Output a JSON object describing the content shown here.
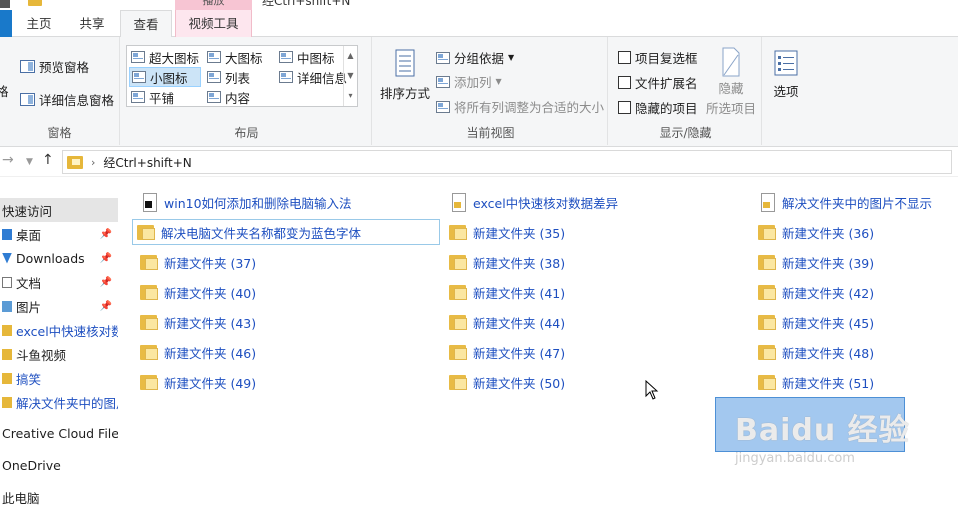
{
  "window": {
    "title": "经Ctrl+shift+N"
  },
  "ribbon_tabs": {
    "context_header": "播放",
    "tabs": [
      "主页",
      "共享",
      "查看",
      "视频工具"
    ],
    "active": "查看"
  },
  "ribbon": {
    "panes_group": {
      "label": "窗格",
      "preview_pane": "预览窗格",
      "details_pane": "详细信息窗格",
      "nav_pane_partial": "格"
    },
    "layout_group": {
      "label": "布局",
      "items": [
        "超大图标",
        "大图标",
        "中图标",
        "小图标",
        "列表",
        "详细信息",
        "平铺",
        "内容"
      ],
      "selected": "小图标"
    },
    "current_view_group": {
      "label": "当前视图",
      "sort_by": "排序方式",
      "group_by": "分组依据",
      "add_columns": "添加列",
      "fit_columns": "将所有列调整为合适的大小"
    },
    "show_hide_group": {
      "label": "显示/隐藏",
      "item_checkboxes": "项目复选框",
      "file_extensions": "文件扩展名",
      "hidden_items": "隐藏的项目",
      "hide_selected": "隐藏",
      "hide_selected_sub": "所选项目"
    },
    "options": "选项"
  },
  "address": {
    "path": "经Ctrl+shift+N"
  },
  "nav_pane": {
    "quick_access": "快速访问",
    "items": [
      {
        "label": "桌面",
        "pinned": true
      },
      {
        "label": "Downloads",
        "pinned": true
      },
      {
        "label": "文档",
        "pinned": true
      },
      {
        "label": "图片",
        "pinned": true
      },
      {
        "label": "excel中快速核对数据差异",
        "pinned": false
      },
      {
        "label": "斗鱼视频",
        "pinned": false
      },
      {
        "label": "搞笑",
        "pinned": false
      },
      {
        "label": "解决文件夹中的图片不显示",
        "pinned": false
      }
    ],
    "creative_cloud": "Creative Cloud Files",
    "onedrive": "OneDrive",
    "this_pc": "此电脑",
    "pin_glyph": "📌"
  },
  "files": {
    "col1": [
      {
        "name": "win10如何添加和删除电脑输入法",
        "type": "doc"
      },
      {
        "name": "解决电脑文件夹名称都变为蓝色字体",
        "type": "folder"
      },
      {
        "name": "新建文件夹 (37)",
        "type": "folder"
      },
      {
        "name": "新建文件夹 (40)",
        "type": "folder"
      },
      {
        "name": "新建文件夹 (43)",
        "type": "folder"
      },
      {
        "name": "新建文件夹 (46)",
        "type": "folder"
      },
      {
        "name": "新建文件夹 (49)",
        "type": "folder"
      }
    ],
    "col2": [
      {
        "name": "excel中快速核对数据差异",
        "type": "doc2"
      },
      {
        "name": "新建文件夹 (35)",
        "type": "folder"
      },
      {
        "name": "新建文件夹 (38)",
        "type": "folder"
      },
      {
        "name": "新建文件夹 (41)",
        "type": "folder"
      },
      {
        "name": "新建文件夹 (44)",
        "type": "folder"
      },
      {
        "name": "新建文件夹 (47)",
        "type": "folder"
      },
      {
        "name": "新建文件夹 (50)",
        "type": "folder"
      }
    ],
    "col3": [
      {
        "name": "解决文件夹中的图片不显示",
        "type": "doc2"
      },
      {
        "name": "新建文件夹 (36)",
        "type": "folder"
      },
      {
        "name": "新建文件夹 (39)",
        "type": "folder"
      },
      {
        "name": "新建文件夹 (42)",
        "type": "folder"
      },
      {
        "name": "新建文件夹 (45)",
        "type": "folder"
      },
      {
        "name": "新建文件夹 (48)",
        "type": "folder"
      },
      {
        "name": "新建文件夹 (51)",
        "type": "folder"
      }
    ]
  },
  "watermark": {
    "main": "Baidu 经验",
    "sub": "jingyan.baidu.com"
  },
  "colors": {
    "file_text": "#1e4fc0",
    "selection": "#a3c8ef",
    "ribbon_bg": "#f5f6f7"
  }
}
